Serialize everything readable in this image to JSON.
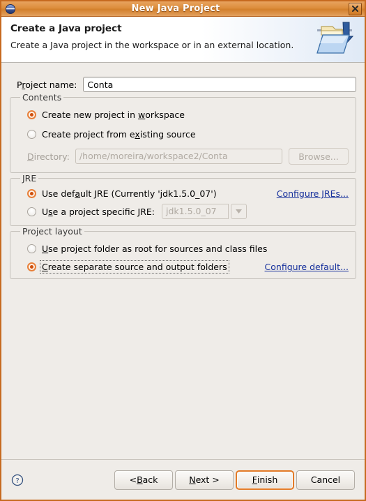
{
  "window": {
    "title": "New Java Project",
    "icon": "java-sphere-icon",
    "close_label": "close-icon",
    "accent_orange": "#d3802c",
    "body_bg": "#efece8",
    "link_color": "#16309c",
    "radio_selected_color": "#cf4f0c"
  },
  "header": {
    "title": "Create a Java project",
    "description": "Create a Java project in the workspace or in an external location.",
    "icon": "java-project-folder-icon"
  },
  "project_name": {
    "label_pre": "P",
    "label_accel": "r",
    "label_post": "oject name:",
    "label_full": "Project name:",
    "value": "Conta",
    "placeholder": ""
  },
  "contents": {
    "legend": "Contents",
    "options": [
      {
        "pre": "Create new project in ",
        "accel": "w",
        "post": "orkspace",
        "full": "Create new project in workspace",
        "checked": true
      },
      {
        "pre": "Create project from e",
        "accel": "x",
        "post": "isting source",
        "full": "Create project from existing source",
        "checked": false
      }
    ],
    "directory": {
      "label_pre": "",
      "label_accel": "D",
      "label_post": "irectory:",
      "label_full": "Directory:",
      "value": "/home/moreira/workspace2/Conta",
      "enabled": false,
      "browse_label": "Browse...",
      "browse_enabled": false
    }
  },
  "jre": {
    "legend": "JRE",
    "options": [
      {
        "pre": "Use def",
        "accel": "a",
        "post": "ult JRE (Currently 'jdk1.5.0_07')",
        "full": "Use default JRE (Currently 'jdk1.5.0_07')",
        "checked": true
      },
      {
        "pre": "U",
        "accel": "s",
        "post": "e a project specific JRE:",
        "full": "Use a project specific JRE:",
        "checked": false
      }
    ],
    "configure_link": "Configure JREs...",
    "combo": {
      "value": "jdk1.5.0_07",
      "enabled": false,
      "options": [
        "jdk1.5.0_07"
      ]
    }
  },
  "project_layout": {
    "legend": "Project layout",
    "options": [
      {
        "pre": "",
        "accel": "U",
        "post": "se project folder as root for sources and class files",
        "full": "Use project folder as root for sources and class files",
        "checked": false,
        "focused": false
      },
      {
        "pre": "",
        "accel": "C",
        "post": "reate separate source and output folders",
        "full": "Create separate source and output folders",
        "checked": true,
        "focused": true
      }
    ],
    "configure_link": "Configure default..."
  },
  "footer": {
    "help_icon": "help-question-icon",
    "buttons": [
      {
        "pre": "< ",
        "accel": "B",
        "post": "ack",
        "full": "< Back",
        "default": false
      },
      {
        "pre": "",
        "accel": "N",
        "post": "ext >",
        "full": "Next >",
        "default": false
      },
      {
        "pre": "",
        "accel": "F",
        "post": "inish",
        "full": "Finish",
        "default": true
      },
      {
        "pre": "Cancel",
        "accel": "",
        "post": "",
        "full": "Cancel",
        "default": false
      }
    ]
  }
}
